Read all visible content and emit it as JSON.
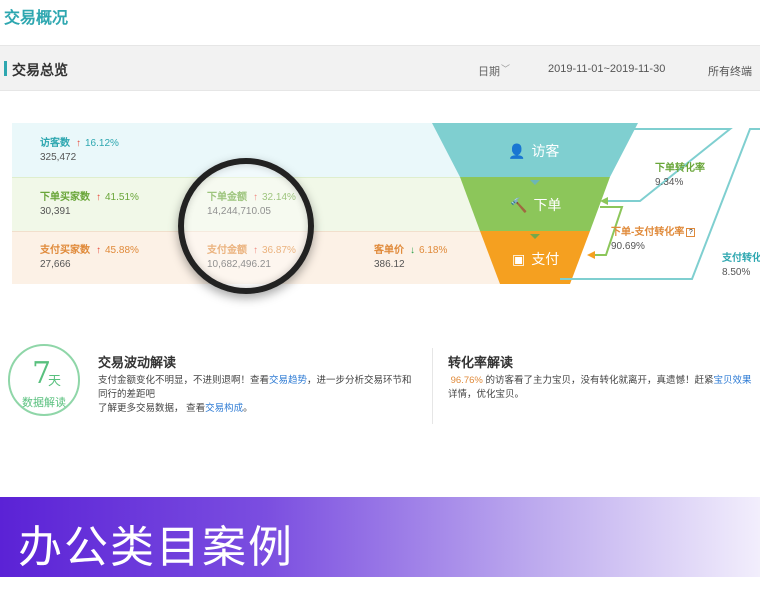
{
  "page_title": "交易概况",
  "overview": {
    "title": "交易总览",
    "date_label": "日期",
    "date_range": "2019-11-01~2019-11-30",
    "terminal": "所有终端"
  },
  "metrics": {
    "visitors": {
      "label": "访客数",
      "pct": "16.12%",
      "value": "325,472",
      "trend": "up"
    },
    "buyers": {
      "label": "下单买家数",
      "pct": "41.51%",
      "value": "30,391",
      "trend": "up"
    },
    "order_amount": {
      "label": "下单金额",
      "pct": "32.14%",
      "value": "14,244,710.05",
      "trend": "up"
    },
    "pay_buyers": {
      "label": "支付买家数",
      "pct": "45.88%",
      "value": "27,666",
      "trend": "up"
    },
    "pay_amount": {
      "label": "支付金额",
      "pct": "36.87%",
      "value": "10,682,496.21",
      "trend": "up"
    },
    "unit_price": {
      "label": "客单价",
      "pct": "6.18%",
      "value": "386.12",
      "trend": "down"
    }
  },
  "funnel": {
    "visit": "访客",
    "order": "下单",
    "pay": "支付",
    "colors": {
      "visit": "#7fcfd0",
      "order": "#8cc65a",
      "pay": "#f5a020"
    }
  },
  "conversions": {
    "order_rate": {
      "label": "下单转化率",
      "value": "9.34%"
    },
    "order_pay_rate": {
      "label": "下单-支付转化率",
      "value": "90.69%"
    },
    "pay_rate": {
      "label": "支付转化",
      "value": "8.50%"
    }
  },
  "badge": {
    "num": "7",
    "unit": "天",
    "sub": "数据解读"
  },
  "fluctuation": {
    "title": "交易波动解读",
    "line1_a": "支付金额变化不明显，不进则退啊！查看",
    "line1_link": "交易趋势",
    "line1_b": "，进一步分析交易环节和",
    "line2": "同行的差距吧",
    "line3_a": "了解更多交易数据，  查看",
    "line3_link": "交易构成",
    "line3_b": "。"
  },
  "conversion_read": {
    "title": "转化率解读",
    "pct": "96.76%",
    "line1_a": " 的访客看了主力宝贝，没有转化就离开，真遗憾！赶紧",
    "line1_link": "宝贝效果",
    "line2": "详情，优化宝贝。"
  },
  "banner": {
    "text": "办公类目案例"
  }
}
